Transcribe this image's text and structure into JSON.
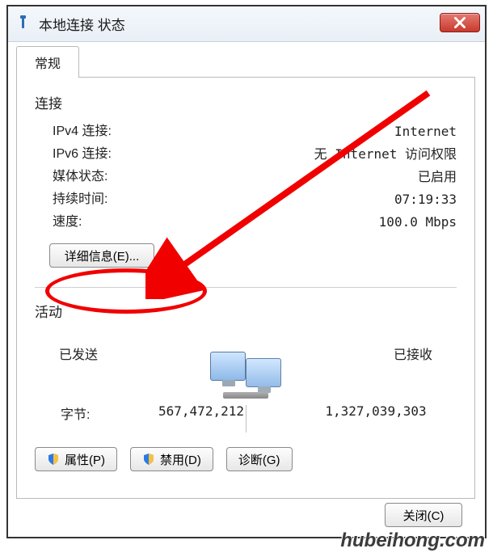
{
  "window": {
    "title": "本地连接 状态"
  },
  "tabs": {
    "general": "常规"
  },
  "connection": {
    "heading": "连接",
    "ipv4_label": "IPv4 连接:",
    "ipv4_value": "Internet",
    "ipv6_label": "IPv6 连接:",
    "ipv6_value": "无 Internet 访问权限",
    "media_label": "媒体状态:",
    "media_value": "已启用",
    "duration_label": "持续时间:",
    "duration_value": "07:19:33",
    "speed_label": "速度:",
    "speed_value": "100.0 Mbps",
    "details_button": "详细信息(E)..."
  },
  "activity": {
    "heading": "活动",
    "sent_label": "已发送",
    "received_label": "已接收",
    "bytes_label": "字节:",
    "bytes_sent": "567,472,212",
    "bytes_received": "1,327,039,303"
  },
  "buttons": {
    "properties": "属性(P)",
    "disable": "禁用(D)",
    "diagnose": "诊断(G)",
    "close": "关闭(C)"
  },
  "watermark": "hubeihong.com"
}
